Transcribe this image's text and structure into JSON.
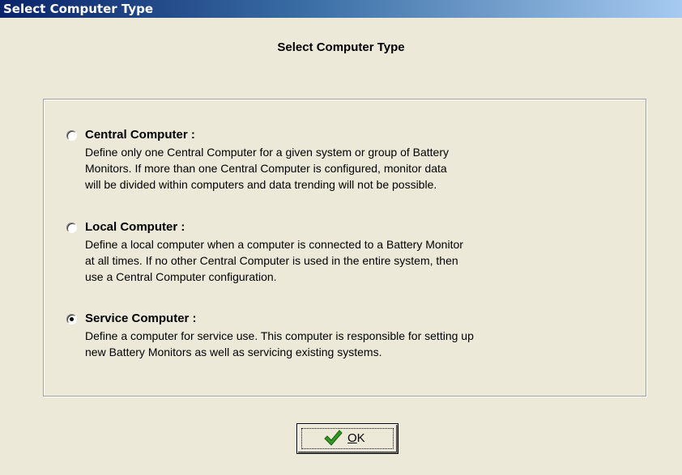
{
  "window": {
    "title": "Select Computer Type"
  },
  "dialog": {
    "heading": "Select Computer Type",
    "options": [
      {
        "label": "Central Computer :",
        "selected": false,
        "description_lines": [
          "Define only one Central Computer for a given system or group of Battery",
          "Monitors. If more than one Central Computer is configured, monitor data",
          "will be divided within computers and data trending will not be possible."
        ]
      },
      {
        "label": "Local Computer :",
        "selected": false,
        "description_lines": [
          "Define a local computer when a computer is connected to a Battery Monitor",
          "at all times. If no other Central Computer is used in the entire system, then",
          "use a Central Computer configuration."
        ]
      },
      {
        "label": "Service Computer :",
        "selected": true,
        "description_lines": [
          "Define a computer for service use. This computer is responsible for setting up",
          "new Battery Monitors as well as servicing existing systems."
        ]
      }
    ],
    "ok_button": {
      "mnemonic": "O",
      "rest": "K",
      "icon": "checkmark-icon",
      "icon_color": "#2e9a1e"
    }
  }
}
